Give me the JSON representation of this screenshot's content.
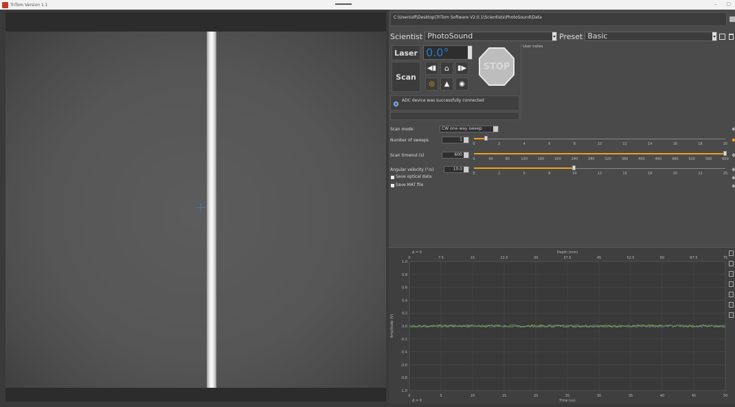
{
  "window": {
    "title": "TriTom Version 1.1"
  },
  "path": "C:\\Users\\df\\Desktop\\TriTom Software V2.0.1\\Scientists\\PhotoSound\\Data",
  "scientist": {
    "label": "Scientist",
    "value": "PhotoSound"
  },
  "preset": {
    "label": "Preset",
    "value": "Basic"
  },
  "controls": {
    "laser": "Laser",
    "scan": "Scan",
    "angle": "0.0°",
    "stop": "STOP"
  },
  "notes": {
    "label": "User notes"
  },
  "status": {
    "message": "ADC device was successfully connected"
  },
  "settings": {
    "scan_mode": {
      "label": "Scan mode",
      "value": "CW one-way sweep"
    },
    "sweeps": {
      "label": "Number of sweeps",
      "value": "1",
      "slider": {
        "min": 0,
        "max": 20,
        "value": 1,
        "ticks": [
          "0",
          "2",
          "4",
          "6",
          "8",
          "10",
          "12",
          "14",
          "16",
          "18",
          "20"
        ]
      }
    },
    "timeout": {
      "label": "Scan timeout (s)",
      "value": "600",
      "slider": {
        "min": 0,
        "max": 600,
        "value": 600,
        "ticks": [
          "0",
          "40",
          "80",
          "120",
          "160",
          "200",
          "240",
          "280",
          "320",
          "360",
          "400",
          "440",
          "480",
          "520",
          "560",
          "600"
        ]
      }
    },
    "velocity": {
      "label": "Angular velocity (°/s)",
      "value": "10.0",
      "slider": {
        "min": 0,
        "max": 25,
        "value": 10,
        "ticks": [
          "0",
          "2",
          "5",
          "8",
          "10",
          "12",
          "15",
          "18",
          "20",
          "22",
          "25"
        ]
      }
    },
    "save_optical": {
      "label": "Save optical data",
      "checked": true
    },
    "save_mat": {
      "label": "Save MAT file",
      "checked": true
    }
  },
  "chart_data": {
    "type": "line",
    "top_axis": {
      "label": "Depth (mm)",
      "delta": "Δ = 0",
      "ticks": [
        "0",
        "7.5",
        "15",
        "22.5",
        "30",
        "37.5",
        "45",
        "52.5",
        "60",
        "67.5",
        "75"
      ]
    },
    "bottom_axis": {
      "label": "Time (us)",
      "delta": "Δ = 0",
      "ticks": [
        "0",
        "5",
        "10",
        "15",
        "20",
        "25",
        "30",
        "35",
        "40",
        "45",
        "50"
      ]
    },
    "y_axis": {
      "label": "Amplitude (V)",
      "ticks": [
        "1.0",
        "0.8",
        "0.6",
        "0.4",
        "0.2",
        "0.0",
        "-0.2",
        "-0.4",
        "-0.6",
        "-0.8",
        "-1.0"
      ],
      "range": [
        -1.0,
        1.0
      ]
    },
    "xlim": [
      0,
      50
    ],
    "series_colors": [
      "#c8b432",
      "#4d7fc4",
      "#6aa84f"
    ],
    "noise_amplitude": 0.02
  }
}
